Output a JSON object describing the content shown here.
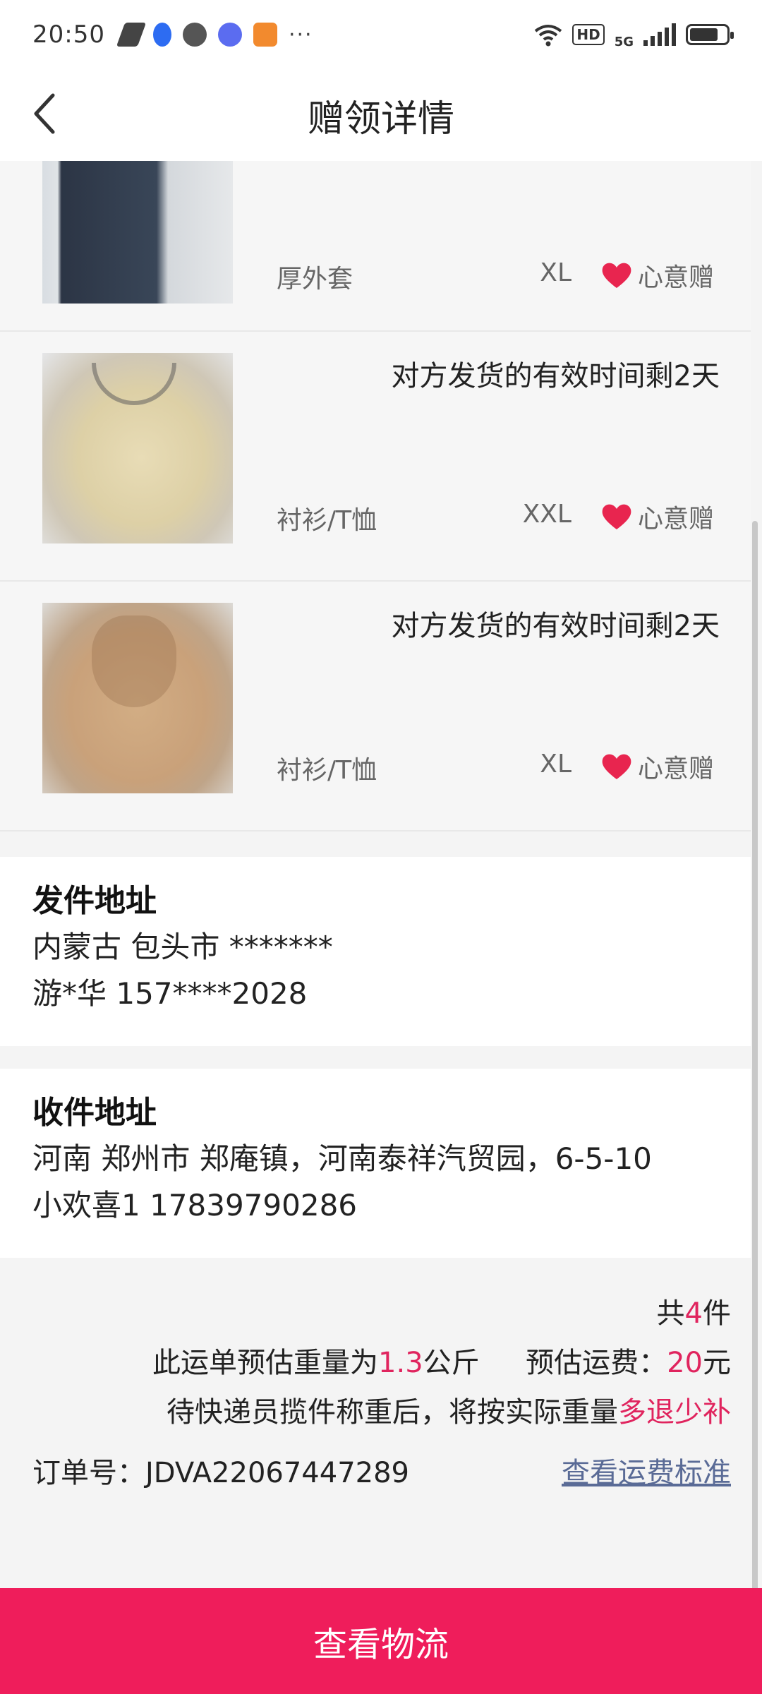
{
  "status_bar": {
    "time": "20:50",
    "more": "···",
    "hd": "HD",
    "network": "5G",
    "icons": [
      "wps-icon",
      "baidu-icon",
      "wechat-icon",
      "music-icon",
      "video-icon",
      "wifi-icon",
      "signal-icon",
      "battery-icon"
    ]
  },
  "header": {
    "title": "赠领详情",
    "back_icon": "chevron-left-icon"
  },
  "items": [
    {
      "notice": "",
      "category": "厚外套",
      "size": "XL",
      "tag": "心意赠"
    },
    {
      "notice": "对方发货的有效时间剩2天",
      "category": "衬衫/T恤",
      "size": "XXL",
      "tag": "心意赠"
    },
    {
      "notice": "对方发货的有效时间剩2天",
      "category": "衬衫/T恤",
      "size": "XL",
      "tag": "心意赠"
    }
  ],
  "sender": {
    "title": "发件地址",
    "address": "内蒙古 包头市 *******",
    "contact": "游*华 157****2028"
  },
  "receiver": {
    "title": "收件地址",
    "address": "河南 郑州市 郑庵镇，河南泰祥汽贸园，6-5-10",
    "contact": "小欢喜1 17839790286"
  },
  "summary": {
    "count_prefix": "共",
    "count": "4",
    "count_suffix": "件",
    "weight_prefix": "此运单预估重量为",
    "weight": "1.3",
    "weight_unit": "公斤",
    "fee_label": "预估运费：",
    "fee": "20",
    "fee_unit": "元",
    "note_prefix": "待快递员揽件称重后，将按实际重量",
    "note_highlight": "多退少补",
    "order_no": "订单号：JDVA22067447289",
    "fee_link": "查看运费标准"
  },
  "bottom_button": "查看物流",
  "colors": {
    "accent": "#ef1d5b",
    "highlight": "#e0245e",
    "link": "#5a6b96"
  }
}
